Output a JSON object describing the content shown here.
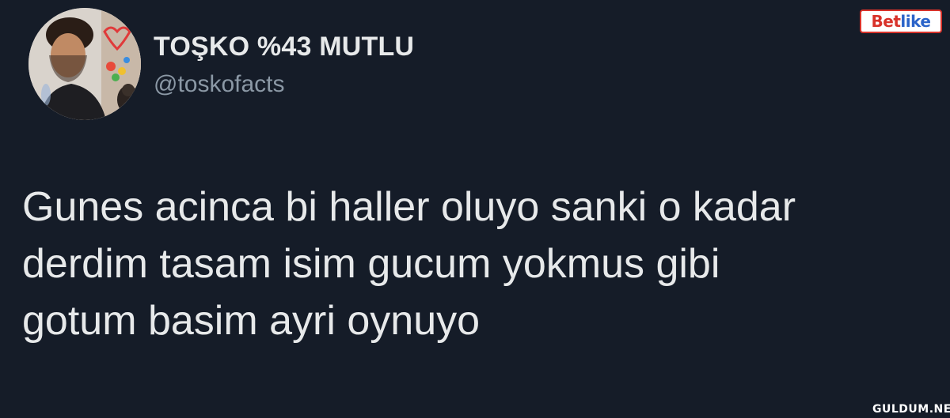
{
  "tweet": {
    "display_name": "TOŞKO %43 MUTLU",
    "handle": "@toskofacts",
    "text": "Gunes acinca bi haller oluyo sanki o kadar\nderdim tasam isim gucum yokmus gibi\ngotum basim ayri oynuyo",
    "avatar_icon": "profile-photo"
  },
  "overlays": {
    "brand_logo": {
      "part1": "Bet",
      "part2": "like"
    },
    "watermark": "GULDUM.NET"
  },
  "colors": {
    "background": "#151c28",
    "text_primary": "#e7e9ea",
    "text_secondary": "#8b98a5"
  }
}
